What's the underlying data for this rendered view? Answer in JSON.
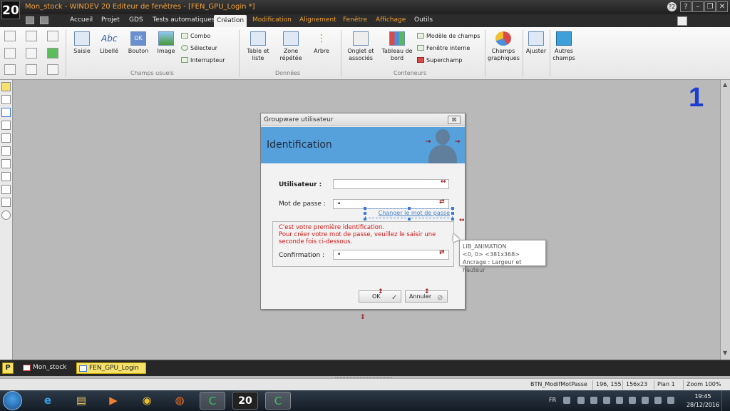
{
  "app": {
    "logo": "20",
    "title": "Mon_stock - WINDEV 20  Editeur de fenêtres - [FEN_GPU_Login *]",
    "help_badge": "?2"
  },
  "menu": {
    "items": [
      "Accueil",
      "Projet",
      "GDS",
      "Tests automatiques",
      "Création",
      "Modification",
      "Alignement",
      "Fenêtre",
      "Affichage",
      "Outils"
    ],
    "active": "Création"
  },
  "ribbon": {
    "champs_usuels": {
      "saisie": "Saisie",
      "libelle": "Libellé",
      "libelle_icon": "Abc",
      "bouton": "Bouton",
      "bouton_icon": "OK",
      "image": "Image",
      "combo": "Combo",
      "selecteur": "Sélecteur",
      "interrupteur": "Interrupteur",
      "group_label": "Champs usuels"
    },
    "donnees": {
      "table_line1": "Table et",
      "table_line2": "liste",
      "zone_line1": "Zone",
      "zone_line2": "répétée",
      "arbre": "Arbre",
      "group_label": "Données"
    },
    "conteneurs": {
      "onglet_line1": "Onglet et",
      "onglet_line2": "associés",
      "tableau_line1": "Tableau de",
      "tableau_line2": "bord",
      "modele": "Modèle de champs",
      "fenetre_interne": "Fenêtre interne",
      "superchamp": "Superchamp",
      "group_label": "Conteneurs"
    },
    "graphs": {
      "champs_line1": "Champs",
      "champs_line2": "graphiques",
      "ajuster": "Ajuster",
      "autres_line1": "Autres",
      "autres_line2": "champs"
    }
  },
  "editor": {
    "page_number": "1"
  },
  "window": {
    "title": "Groupware utilisateur",
    "close_glyph": "⊠",
    "banner_title": "Identification",
    "utilisateur_label": "Utilisateur :",
    "password_label": "Mot de passe :",
    "password_value": "•",
    "change_password_link": "Changer le mot de passe",
    "info_line1": "C'est votre première identification.",
    "info_line2": "Pour créer votre mot de passe, veuillez le saisir une",
    "info_line3": "seconde fois ci-dessous.",
    "confirmation_label": "Confirmation :",
    "confirmation_value": "•",
    "ok_label": "OK",
    "cancel_label": "Annuler"
  },
  "tooltip": {
    "name": "LIB_ANIMATION",
    "geometry": "<0, 0> <381x368>",
    "anchor": "Ancrage : Largeur et hauteur"
  },
  "tabs": {
    "p_badge": "P",
    "items": [
      "Mon_stock",
      "FEN_GPU_Login"
    ]
  },
  "status": {
    "control": "BTN_ModifMotPasse",
    "position": "196, 155",
    "size": "156x23",
    "plan": "Plan 1",
    "zoom": "Zoom 100%"
  },
  "taskbar": {
    "lang": "FR",
    "time": "19:45",
    "date": "28/12/2016"
  }
}
